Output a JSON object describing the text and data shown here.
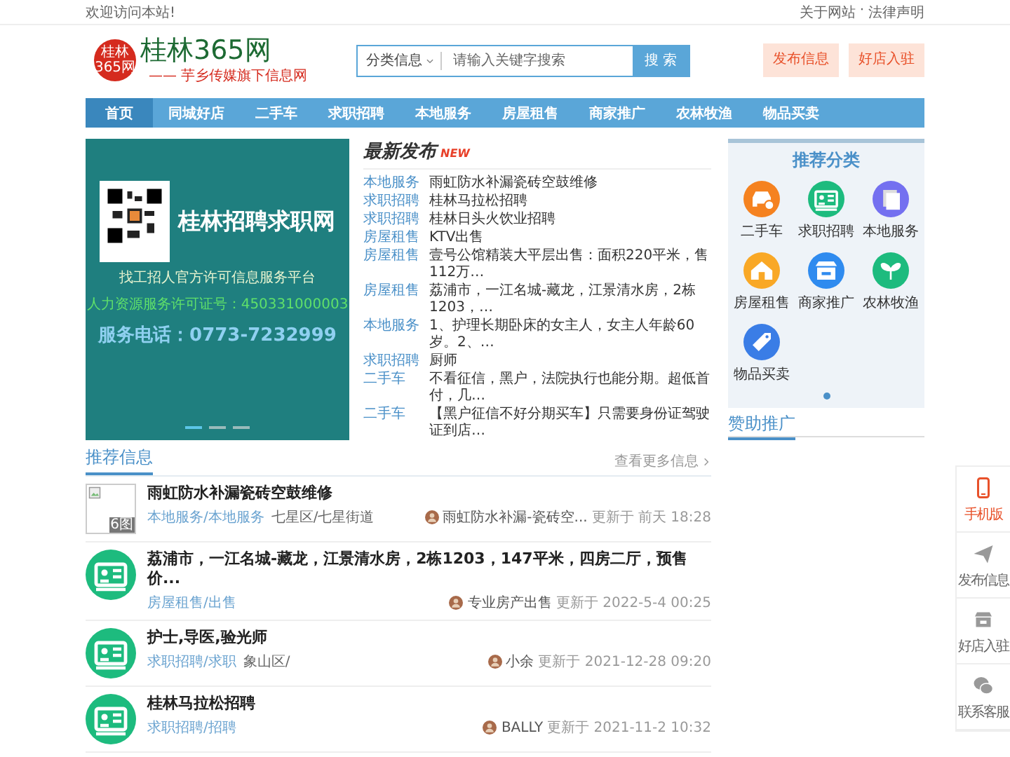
{
  "top_bar": {
    "welcome": "欢迎访问本站!",
    "links": [
      "关于网站",
      "法律声明"
    ],
    "separator": "·"
  },
  "logo": {
    "badge_lines": [
      "桂林",
      "365网"
    ],
    "title": "桂林365网",
    "slogan": "—— 芋乡传媒旗下信息网"
  },
  "search": {
    "category": "分类信息",
    "placeholder": "请输入关键字搜索",
    "button": "搜 索"
  },
  "header_buttons": [
    "发布信息",
    "好店入驻"
  ],
  "nav": [
    {
      "label": "首页",
      "selected": true
    },
    {
      "label": "同城好店",
      "selected": false
    },
    {
      "label": "二手车",
      "selected": false
    },
    {
      "label": "求职招聘",
      "selected": false
    },
    {
      "label": "本地服务",
      "selected": false
    },
    {
      "label": "房屋租售",
      "selected": false
    },
    {
      "label": "商家推广",
      "selected": false
    },
    {
      "label": "农林牧渔",
      "selected": false
    },
    {
      "label": "物品买卖",
      "selected": false
    }
  ],
  "banner": {
    "title": "桂林招聘求职网",
    "subtitle": "找工招人官方许可信息服务平台",
    "license": "人力资源服务许可证号：450331000003",
    "phone": "服务电话：0773-7232999",
    "slides": [
      {
        "selected": true
      },
      {
        "selected": false
      },
      {
        "selected": false
      }
    ]
  },
  "latest": {
    "title": "最新发布",
    "badge": "NEW",
    "items": [
      {
        "category": "本地服务",
        "title": "雨虹防水补漏瓷砖空鼓维修"
      },
      {
        "category": "求职招聘",
        "title": "桂林马拉松招聘"
      },
      {
        "category": "求职招聘",
        "title": "桂林日头火饮业招聘"
      },
      {
        "category": "房屋租售",
        "title": "KTV出售"
      },
      {
        "category": "房屋租售",
        "title": "壹号公馆精装大平层出售：面积220平米，售112万…"
      },
      {
        "category": "房屋租售",
        "title": "荔浦市，一江名城-藏龙，江景清水房，2栋1203，…"
      },
      {
        "category": "本地服务",
        "title": "1、护理长期卧床的女主人，女主人年龄60岁。2、…"
      },
      {
        "category": "求职招聘",
        "title": "厨师"
      },
      {
        "category": "二手车",
        "title": "不看征信，黑户，法院执行也能分期。超低首付，几…"
      },
      {
        "category": "二手车",
        "title": "【黑户征信不好分期买车】只需要身份证驾驶证到店…"
      }
    ]
  },
  "categories": {
    "title": "推荐分类",
    "items": [
      {
        "label": "二手车",
        "kind": "car",
        "color": "#f58220"
      },
      {
        "label": "求职招聘",
        "kind": "id_card",
        "color": "#1dbb7e"
      },
      {
        "label": "本地服务",
        "kind": "pages",
        "color": "#7470f0"
      },
      {
        "label": "房屋租售",
        "kind": "house",
        "color": "#f9a826"
      },
      {
        "label": "商家推广",
        "kind": "shop",
        "color": "#2f8bef"
      },
      {
        "label": "农林牧渔",
        "kind": "sprout",
        "color": "#1dbb7e"
      },
      {
        "label": "物品买卖",
        "kind": "tag",
        "color": "#3a7de6"
      }
    ]
  },
  "sponsor": {
    "title": "赞助推广"
  },
  "recommended": {
    "title": "推荐信息",
    "more": "查看更多信息",
    "items": [
      {
        "kind": "image",
        "image_badge": "6图",
        "title": "雨虹防水补漏瓷砖空鼓维修",
        "category": "本地服务/本地服务",
        "area": "七星区/七星街道",
        "author": "雨虹防水补漏-瓷砖空...",
        "updated": "更新于 前天 18:28"
      },
      {
        "kind": "id_card",
        "title": "荔浦市，一江名城-藏龙，江景清水房，2栋1203，147平米，四房二厅，预售价...",
        "category": "房屋租售/出售",
        "author": "专业房产出售",
        "updated": "更新于 2022-5-4 00:25"
      },
      {
        "kind": "id_card",
        "title": "护士,导医,验光师",
        "category": "求职招聘/求职",
        "area": "象山区/",
        "author": "小余",
        "updated": "更新于 2021-12-28 09:20"
      },
      {
        "kind": "id_card",
        "title": "桂林马拉松招聘",
        "category": "求职招聘/招聘",
        "author": "BALLY",
        "updated": "更新于 2021-11-2 10:32"
      }
    ]
  },
  "side_tools": [
    {
      "label": "手机版",
      "kind": "phone",
      "selected": true
    },
    {
      "label": "发布信息",
      "kind": "plane",
      "selected": false
    },
    {
      "label": "好店入驻",
      "kind": "shop",
      "selected": false
    },
    {
      "label": "联系客服",
      "kind": "chat",
      "selected": false
    }
  ]
}
